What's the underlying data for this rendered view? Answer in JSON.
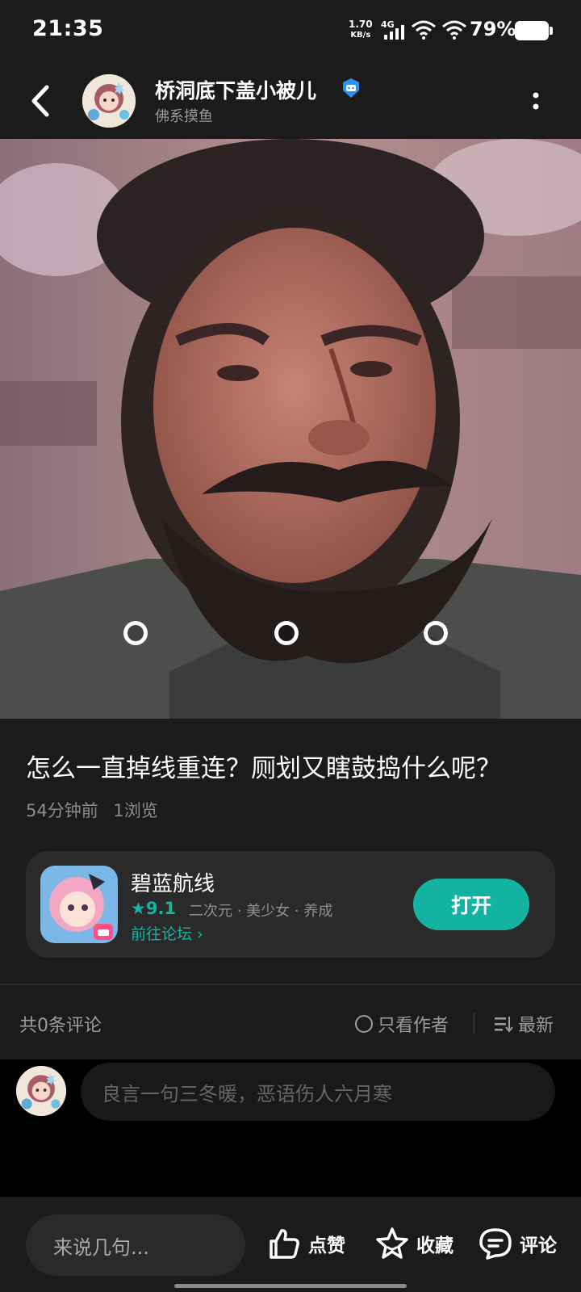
{
  "status_bar": {
    "time": "21:35",
    "net_speed_value": "1.70",
    "net_speed_unit": "KB/s",
    "network_type": "4G",
    "battery_percent": "79%",
    "battery_level": 0.79
  },
  "header": {
    "author_name": "桥洞底下盖小被儿",
    "author_tag": "佛系摸鱼",
    "back_icon": "chevron-left-icon",
    "more_icon": "more-vertical-icon",
    "verified_icon": "verified-badge-icon"
  },
  "post": {
    "title": "怎么一直掉线重连？厕划又瞎鼓捣什么呢？",
    "time_ago": "54分钟前",
    "views": "1浏览",
    "image_page_dots": 3
  },
  "game_card": {
    "name": "碧蓝航线",
    "rating": "★9.1",
    "tags": "二次元 · 美少女 · 养成",
    "forum_link": "前往论坛 ›",
    "open_button": "打开",
    "accent_color": "#12b3a1"
  },
  "comments": {
    "count_label": "共0条评论",
    "author_only_label": "只看作者",
    "sort_label": "最新",
    "input_placeholder": "良言一句三冬暖，恶语伤人六月寒"
  },
  "bottom_bar": {
    "quick_input_placeholder": "来说几句...",
    "like_label": "点赞",
    "favorite_label": "收藏",
    "comment_label": "评论"
  }
}
